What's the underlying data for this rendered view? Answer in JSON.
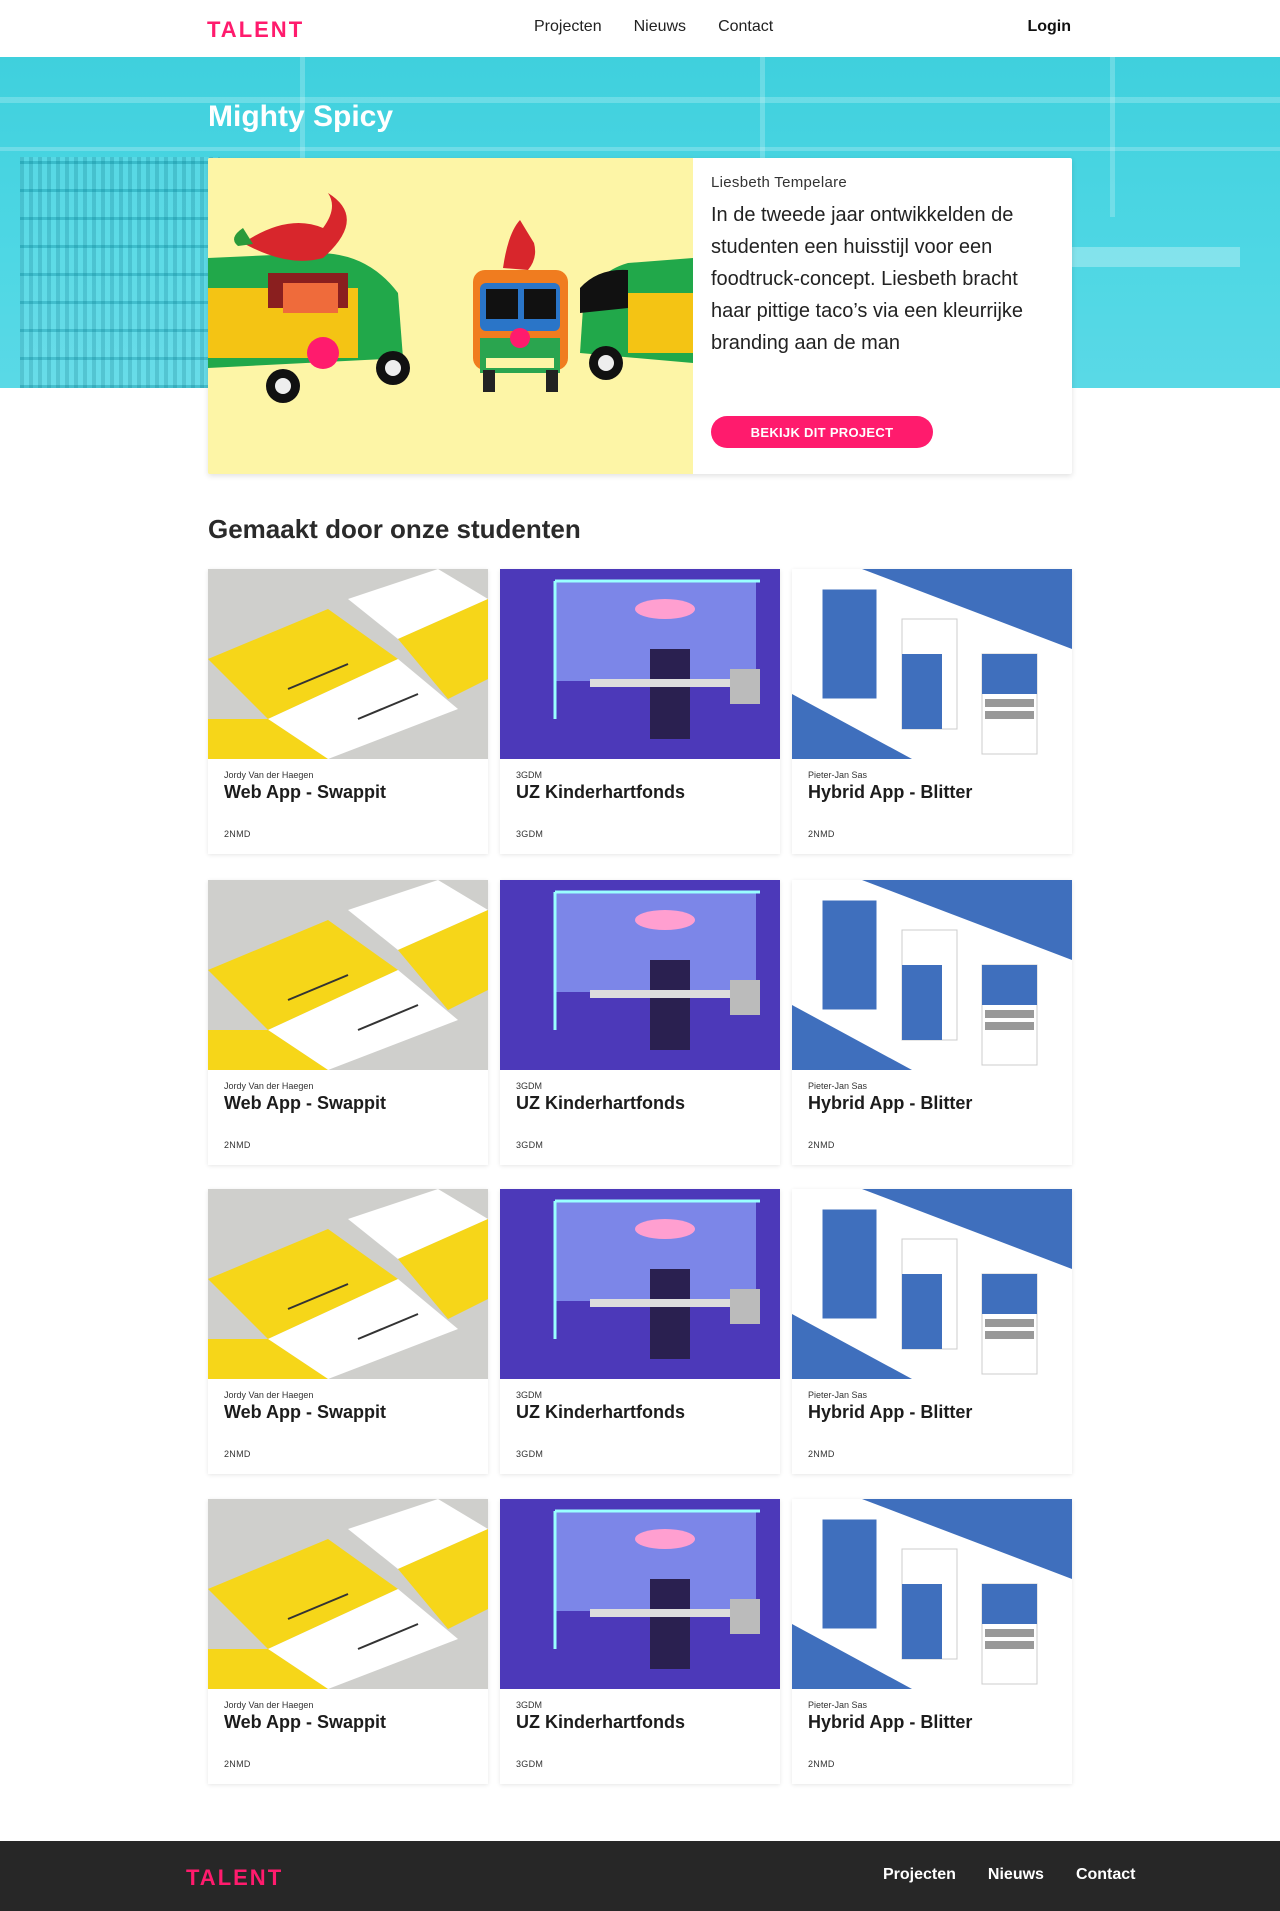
{
  "header": {
    "logo": "TALENT",
    "nav": [
      "Projecten",
      "Nieuws",
      "Contact"
    ],
    "login": "Login"
  },
  "hero": {
    "title": "Mighty Spicy",
    "author": "Liesbeth Tempelare",
    "description": "In de tweede jaar ontwikkelden de studenten een huisstijl voor een foodtruck-concept. Liesbeth bracht haar pittige taco’s via een kleurrijke branding aan de man",
    "button": "BEKIJK DIT PROJECT"
  },
  "section": {
    "title": "Gemaakt door onze studenten"
  },
  "projects": [
    [
      {
        "author": "Jordy Van der Haegen",
        "title": "Web App - Swappit",
        "tag": "2NMD",
        "image": "yellow-documents"
      },
      {
        "author": "3GDM",
        "title": "UZ Kinderhartfonds",
        "tag": "3GDM",
        "image": "purple-installation"
      },
      {
        "author": "Pieter-Jan Sas",
        "title": "Hybrid App - Blitter",
        "tag": "2NMD",
        "image": "blue-mockup"
      }
    ],
    [
      {
        "author": "Jordy Van der Haegen",
        "title": "Web App - Swappit",
        "tag": "2NMD",
        "image": "yellow-documents"
      },
      {
        "author": "3GDM",
        "title": "UZ Kinderhartfonds",
        "tag": "3GDM",
        "image": "purple-installation"
      },
      {
        "author": "Pieter-Jan Sas",
        "title": "Hybrid App - Blitter",
        "tag": "2NMD",
        "image": "blue-mockup"
      }
    ],
    [
      {
        "author": "Jordy Van der Haegen",
        "title": "Web App - Swappit",
        "tag": "2NMD",
        "image": "yellow-documents"
      },
      {
        "author": "3GDM",
        "title": "UZ Kinderhartfonds",
        "tag": "3GDM",
        "image": "purple-installation"
      },
      {
        "author": "Pieter-Jan Sas",
        "title": "Hybrid App - Blitter",
        "tag": "2NMD",
        "image": "blue-mockup"
      }
    ],
    [
      {
        "author": "Jordy Van der Haegen",
        "title": "Web App - Swappit",
        "tag": "2NMD",
        "image": "yellow-documents"
      },
      {
        "author": "3GDM",
        "title": "UZ Kinderhartfonds",
        "tag": "3GDM",
        "image": "purple-installation"
      },
      {
        "author": "Pieter-Jan Sas",
        "title": "Hybrid App - Blitter",
        "tag": "2NMD",
        "image": "blue-mockup"
      }
    ]
  ],
  "footer": {
    "logo": "TALENT",
    "nav": [
      "Projecten",
      "Nieuws",
      "Contact"
    ]
  },
  "colors": {
    "accent": "#ff1b6d",
    "hero_bg": "#4ed7e4",
    "footer_bg": "#272727"
  }
}
